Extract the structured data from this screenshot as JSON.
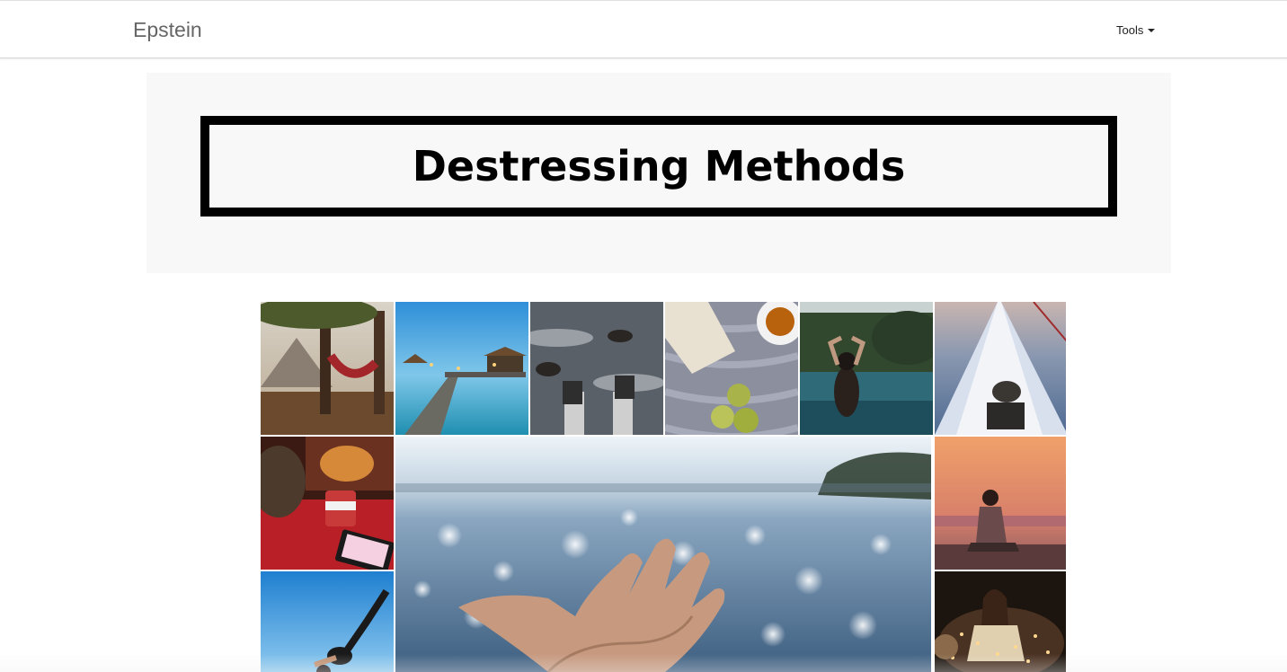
{
  "navbar": {
    "brand": "Epstein",
    "tools_label": "Tools"
  },
  "header": {
    "title": "Destressing Methods"
  },
  "gallery": {
    "photos": [
      {
        "icon": "hammock-mountain-photo"
      },
      {
        "icon": "pier-lanterns-photo"
      },
      {
        "icon": "feet-rocks-water-photo"
      },
      {
        "icon": "book-tea-pears-photo"
      },
      {
        "icon": "infinity-pool-photo"
      },
      {
        "icon": "boat-bow-dog-photo"
      },
      {
        "icon": "fireplace-mug-photo"
      },
      {
        "icon": "hand-sea-sparkle-photo"
      },
      {
        "icon": "woman-sunset-photo"
      },
      {
        "icon": "yoga-pose-sky-photo"
      },
      {
        "icon": "woman-fairy-lights-photo"
      }
    ]
  }
}
